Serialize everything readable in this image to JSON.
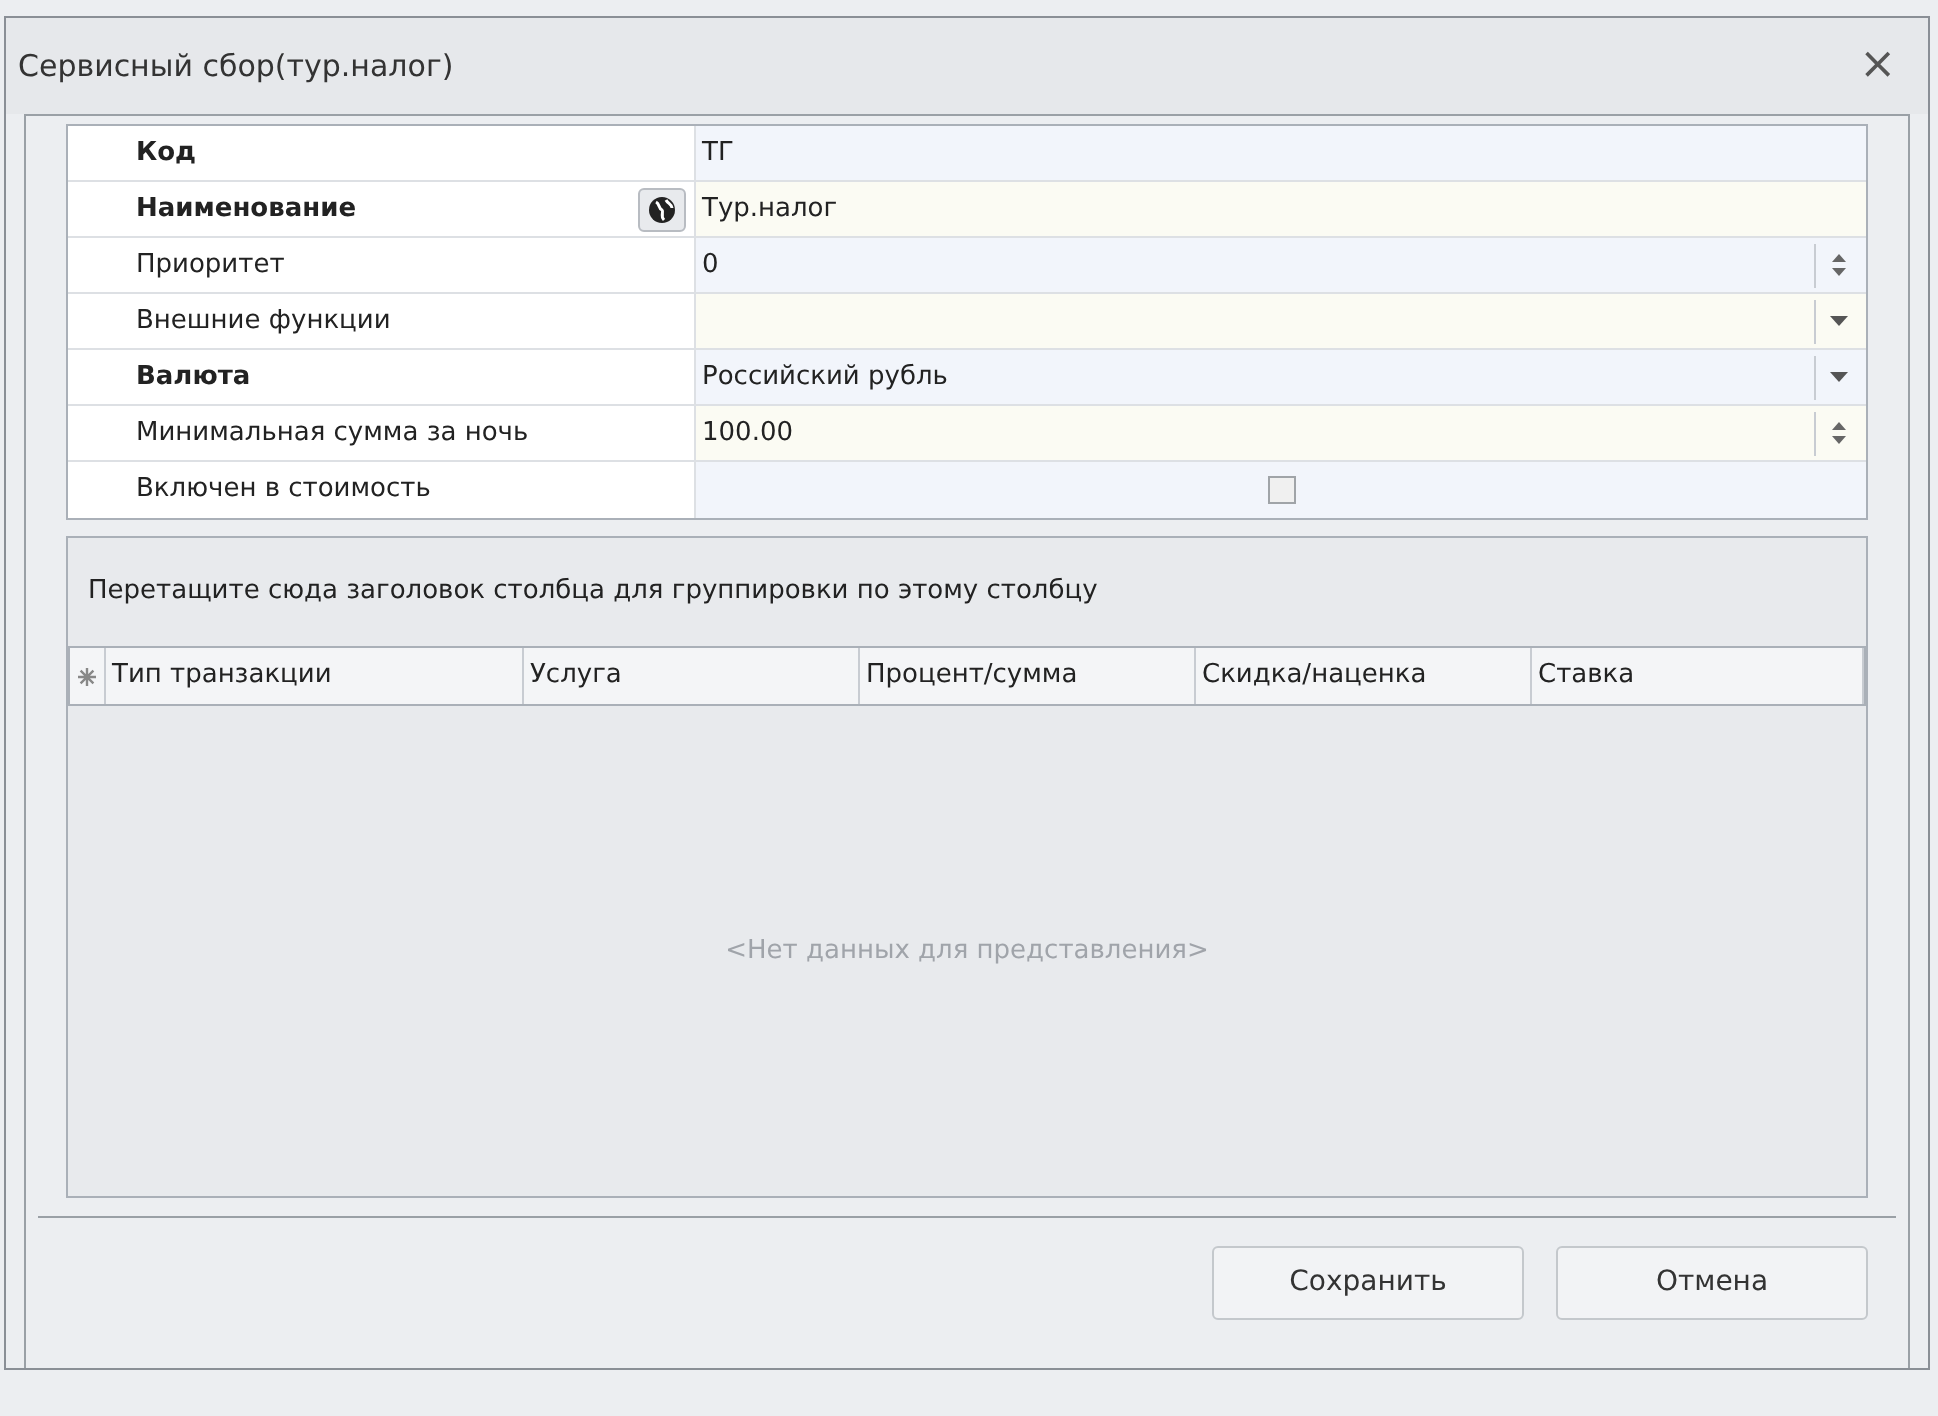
{
  "window": {
    "title": "Сервисный сбор(тур.налог)",
    "close": "×"
  },
  "properties": [
    {
      "label": "Код",
      "bold": true,
      "kind": "text",
      "value": "ТГ"
    },
    {
      "label": "Наименование",
      "bold": true,
      "kind": "localized",
      "value": "Тур.налог"
    },
    {
      "label": "Приоритет",
      "bold": false,
      "kind": "spin",
      "value": "0"
    },
    {
      "label": "Внешние функции",
      "bold": false,
      "kind": "dropdown"
    },
    {
      "label": "Валюта",
      "bold": true,
      "kind": "dropdown",
      "value": "Российский рубль"
    },
    {
      "label": "Минимальная сумма за ночь",
      "bold": false,
      "kind": "spin",
      "value": "100.00"
    },
    {
      "label": "Включен в стоимость",
      "bold": false,
      "kind": "checkbox",
      "checked": false
    }
  ],
  "grid": {
    "group_hint": "Перетащите сюда заголовок столбца для группировки по этому столбцу",
    "columns": [
      "Тип транзакции",
      "Услуга",
      "Процент/сумма",
      "Скидка/наценка",
      "Ставка"
    ],
    "empty_text": "<Нет данных для представления>"
  },
  "buttons": [
    "Сохранить",
    "Отмена"
  ]
}
